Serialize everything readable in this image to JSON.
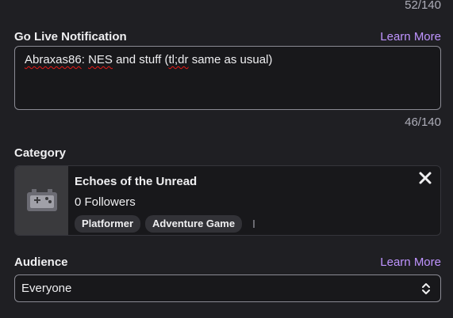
{
  "title_counter": "52/140",
  "go_live": {
    "label": "Go Live Notification",
    "learn_more": "Learn More",
    "value_parts": {
      "w1": "Abraxas86",
      "s1": ": ",
      "w2": "NES",
      "s2": " and stuff (",
      "w3": "tl;dr",
      "s3": " same as usual)"
    },
    "counter": "46/140"
  },
  "category": {
    "label": "Category",
    "name": "Echoes of the Unread",
    "followers": "0 Followers",
    "tags": [
      "Platformer",
      "Adventure Game"
    ],
    "thumb_icon": "gamepad-icon",
    "close_icon": "close-icon"
  },
  "audience": {
    "label": "Audience",
    "learn_more": "Learn More",
    "selected": "Everyone",
    "select_icon": "up-down-chevron-icon"
  },
  "colors": {
    "background": "#1f1f23",
    "accent": "#bf94ff",
    "input_bg": "#18181b",
    "muted_text": "#adadb8"
  }
}
